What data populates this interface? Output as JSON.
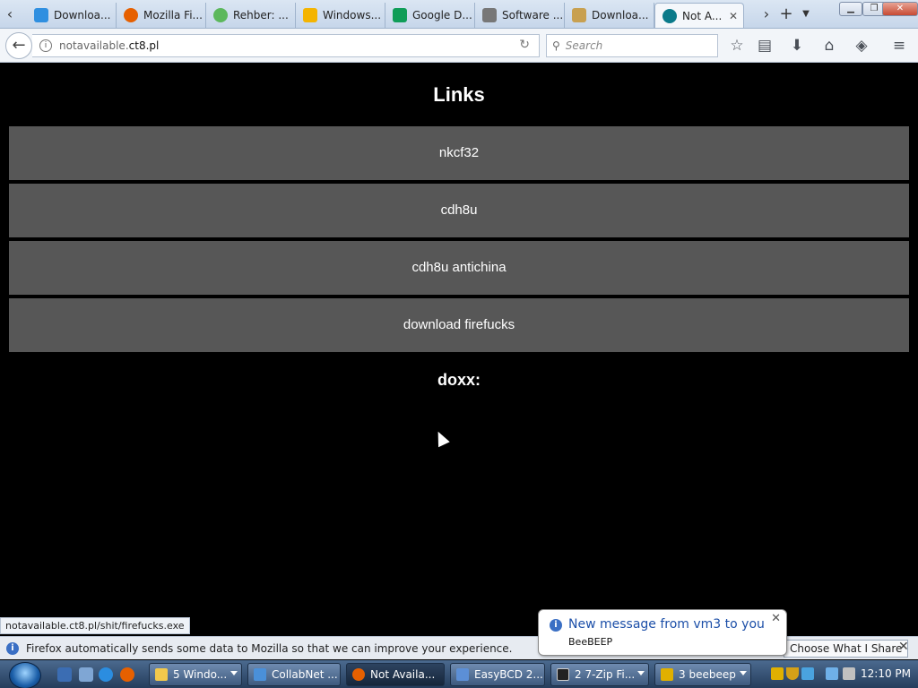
{
  "browser": {
    "tabs": [
      {
        "label": "Downloa...",
        "icon": "download-icon",
        "color": "#2f8fe0"
      },
      {
        "label": "Mozilla Fi...",
        "icon": "firefox-icon",
        "color": "#e66000"
      },
      {
        "label": "Rehber: ...",
        "icon": "power-icon",
        "color": "#5cb85c"
      },
      {
        "label": "Windows...",
        "icon": "drive-icon",
        "color": "#f4b400"
      },
      {
        "label": "Google D...",
        "icon": "drive-icon",
        "color": "#0f9d58"
      },
      {
        "label": "Software ...",
        "icon": "gear-icon",
        "color": "#777777"
      },
      {
        "label": "Downloa...",
        "icon": "download-icon",
        "color": "#c8a050"
      },
      {
        "label": "Not A...",
        "icon": "question-icon",
        "color": "#0a7a8a"
      }
    ],
    "url_prefix": "notavailable.",
    "url_host": "ct8.pl",
    "search_placeholder": "Search"
  },
  "page": {
    "title": "Links",
    "links": [
      "nkcf32",
      "cdh8u",
      "cdh8u antichina",
      "download firefucks"
    ],
    "doxx_label": "doxx:"
  },
  "status": {
    "link_url": "notavailable.ct8.pl/shit/firefucks.exe"
  },
  "notification_bar": {
    "message": "Firefox automatically sends some data to Mozilla so that we can improve your experience.",
    "button": "Choose What I Share"
  },
  "balloon": {
    "title": "New message from vm3 to you",
    "subtitle": "BeeBEEP"
  },
  "taskbar": {
    "buttons": [
      {
        "label": "5 Windo...",
        "color": "#f2c94c"
      },
      {
        "label": "CollabNet ...",
        "color": "#4a90d9"
      },
      {
        "label": "Not Availa...",
        "color": "#e66000"
      },
      {
        "label": "EasyBCD 2....",
        "color": "#5c8fd6"
      },
      {
        "label": "2 7-Zip Fi...",
        "color": "#222222"
      },
      {
        "label": "3 beebeep",
        "color": "#e0b000"
      }
    ],
    "clock": "12:10 PM"
  }
}
